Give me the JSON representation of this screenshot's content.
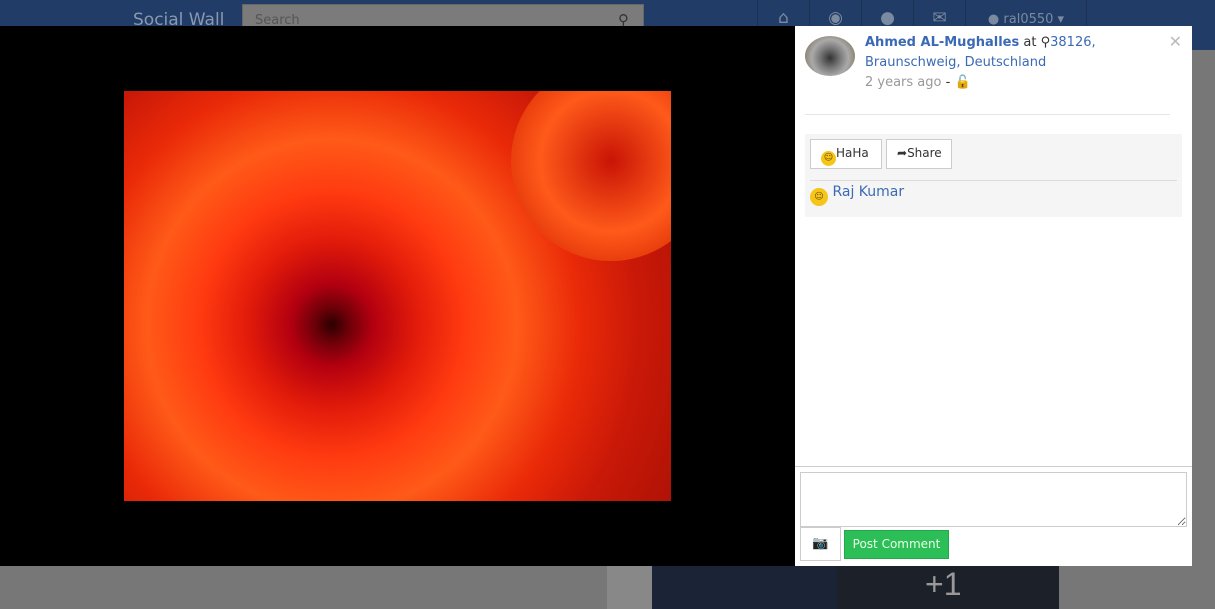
{
  "navbar": {
    "brand": "Social Wall",
    "search_placeholder": "Search",
    "username": "ral0550"
  },
  "background": {
    "more_count": "+1"
  },
  "post": {
    "author": "Ahmed AL-Mughalles",
    "at": "at",
    "location": "38126, Braunschweig, Deutschland",
    "time": "2 years ago",
    "separator": "-"
  },
  "actions": {
    "reaction_label": "HaHa",
    "share_label": "Share"
  },
  "reactions": [
    {
      "name": "Raj Kumar",
      "type": "haha"
    }
  ],
  "comment": {
    "placeholder": "",
    "post_label": "Post Comment"
  }
}
